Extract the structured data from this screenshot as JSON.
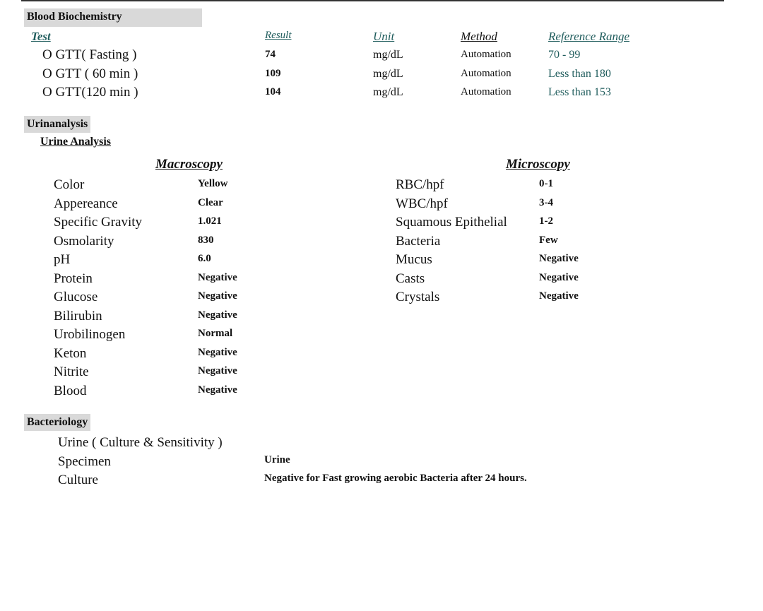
{
  "blood_biochemistry": {
    "title": "Blood Biochemistry",
    "headers": {
      "test": "Test",
      "result": "Result",
      "unit": "Unit",
      "method": "Method",
      "reference": "Reference Range"
    },
    "rows": [
      {
        "test": "O GTT(  Fasting )",
        "result": "74",
        "unit": "mg/dL",
        "method": "Automation",
        "reference": "70 - 99"
      },
      {
        "test": "O GTT ( 60 min )",
        "result": "109",
        "unit": "mg/dL",
        "method": "Automation",
        "reference": "Less than 180"
      },
      {
        "test": "O GTT(120 min )",
        "result": "104",
        "unit": "mg/dL",
        "method": "Automation",
        "reference": "Less than 153"
      }
    ]
  },
  "urinalysis": {
    "title": "Urinanalysis",
    "subtitle": "Urine Analysis",
    "macroscopy_title": "Macroscopy",
    "microscopy_title": "Microscopy",
    "macroscopy": [
      {
        "label": "Color",
        "value": "Yellow"
      },
      {
        "label": "Appereance",
        "value": "Clear"
      },
      {
        "label": "Specific Gravity",
        "value": "1.021"
      },
      {
        "label": "Osmolarity",
        "value": "830"
      },
      {
        "label": "pH",
        "value": "6.0"
      },
      {
        "label": "Protein",
        "value": "Negative"
      },
      {
        "label": "Glucose",
        "value": "Negative"
      },
      {
        "label": "Bilirubin",
        "value": "Negative"
      },
      {
        "label": "Urobilinogen",
        "value": "Normal"
      },
      {
        "label": "Keton",
        "value": "Negative"
      },
      {
        "label": "Nitrite",
        "value": "Negative"
      },
      {
        "label": "Blood",
        "value": "Negative"
      }
    ],
    "microscopy": [
      {
        "label": "RBC/hpf",
        "value": "0-1"
      },
      {
        "label": "WBC/hpf",
        "value": "3-4"
      },
      {
        "label": "Squamous Epithelial",
        "value": "1-2"
      },
      {
        "label": "Bacteria",
        "value": "Few"
      },
      {
        "label": "Mucus",
        "value": "Negative"
      },
      {
        "label": "Casts",
        "value": "Negative"
      },
      {
        "label": "Crystals",
        "value": "Negative"
      }
    ]
  },
  "bacteriology": {
    "title": "Bacteriology",
    "test": "Urine ( Culture & Sensitivity )",
    "rows": [
      {
        "label": "Specimen",
        "value": "Urine"
      },
      {
        "label": "Culture",
        "value": "Negative for Fast growing aerobic Bacteria after 24 hours."
      }
    ]
  }
}
